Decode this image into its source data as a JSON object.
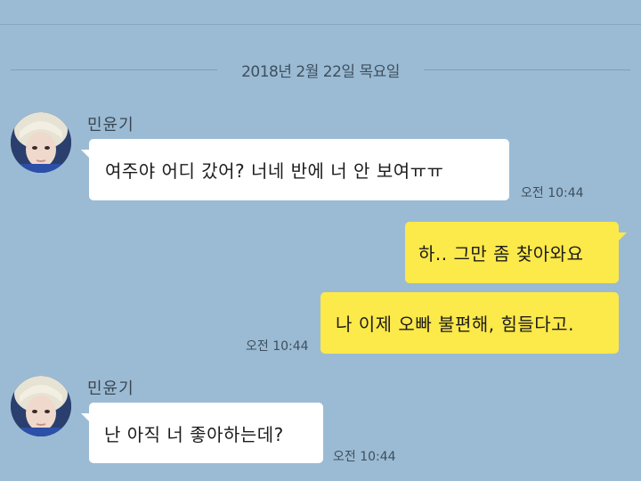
{
  "date_divider": "2018년 2월 22일 목요일",
  "messages": [
    {
      "sender": "민윤기",
      "text": "여주야 어디 갔어? 너네 반에 너 안 보여ㅠㅠ",
      "time": "오전 10:44"
    },
    {
      "text": "하.. 그만 좀 찾아와요"
    },
    {
      "text": "나 이제 오빠 불편해, 힘들다고.",
      "time": "오전 10:44"
    },
    {
      "sender": "민윤기",
      "text": "난 아직 너 좋아하는데?",
      "time": "오전 10:44"
    }
  ],
  "colors": {
    "background": "#9bbbd4",
    "my_bubble": "#fce94a",
    "their_bubble": "#ffffff"
  }
}
